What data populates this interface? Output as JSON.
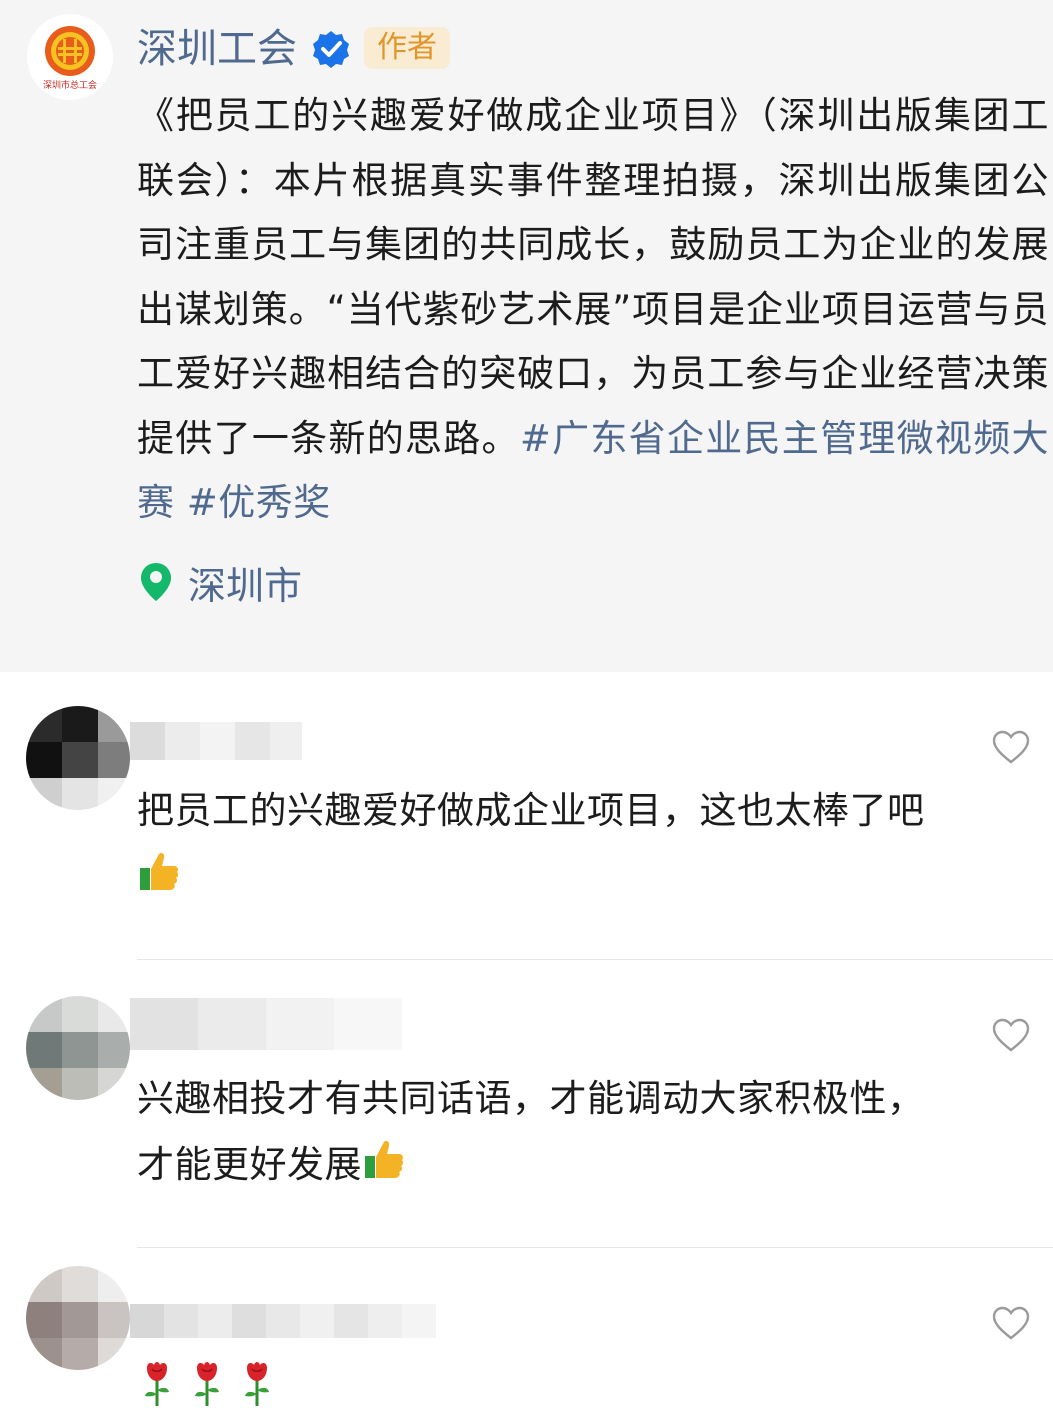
{
  "post": {
    "author": "深圳工会",
    "author_badge": "作者",
    "logo_text": "深圳市总工会",
    "body_text": "《把员工的兴趣爱好做成企业项目》（深圳出版集团工联会）：本片根据真实事件整理拍摄，深圳出版集团公司注重员工与集团的共同成长，鼓励员工为企业的发展出谋划策。“当代紫砂艺术展”项目是企业项目运营与员工爱好兴趣相结合的突破口，为员工参与企业经营决策提供了一条新的思路。",
    "hashtags": [
      "#广东省企业民主管理微视频大赛",
      "#优秀奖"
    ],
    "location": "深圳市",
    "icons": {
      "verified": "verified-check-icon",
      "location": "location-pin-icon"
    }
  },
  "comments": [
    {
      "text": "把员工的兴趣爱好做成企业项目，这也太棒了吧",
      "emoji": "thumbs-up-icon",
      "like_icon": "heart-outline-icon"
    },
    {
      "text": "兴趣相投才有共同话语，才能调动大家积极性，才能更好发展",
      "emoji": "thumbs-up-icon",
      "like_icon": "heart-outline-icon"
    },
    {
      "text": "",
      "emoji": [
        "rose-icon",
        "rose-icon",
        "rose-icon"
      ],
      "like_icon": "heart-outline-icon"
    }
  ],
  "colors": {
    "link_blue": "#4f6a8e",
    "badge_bg": "#faecd2",
    "badge_text": "#e0962a",
    "location_green": "#13b86a",
    "verified_blue": "#1a73e8",
    "post_bg": "#f5f5f6"
  }
}
